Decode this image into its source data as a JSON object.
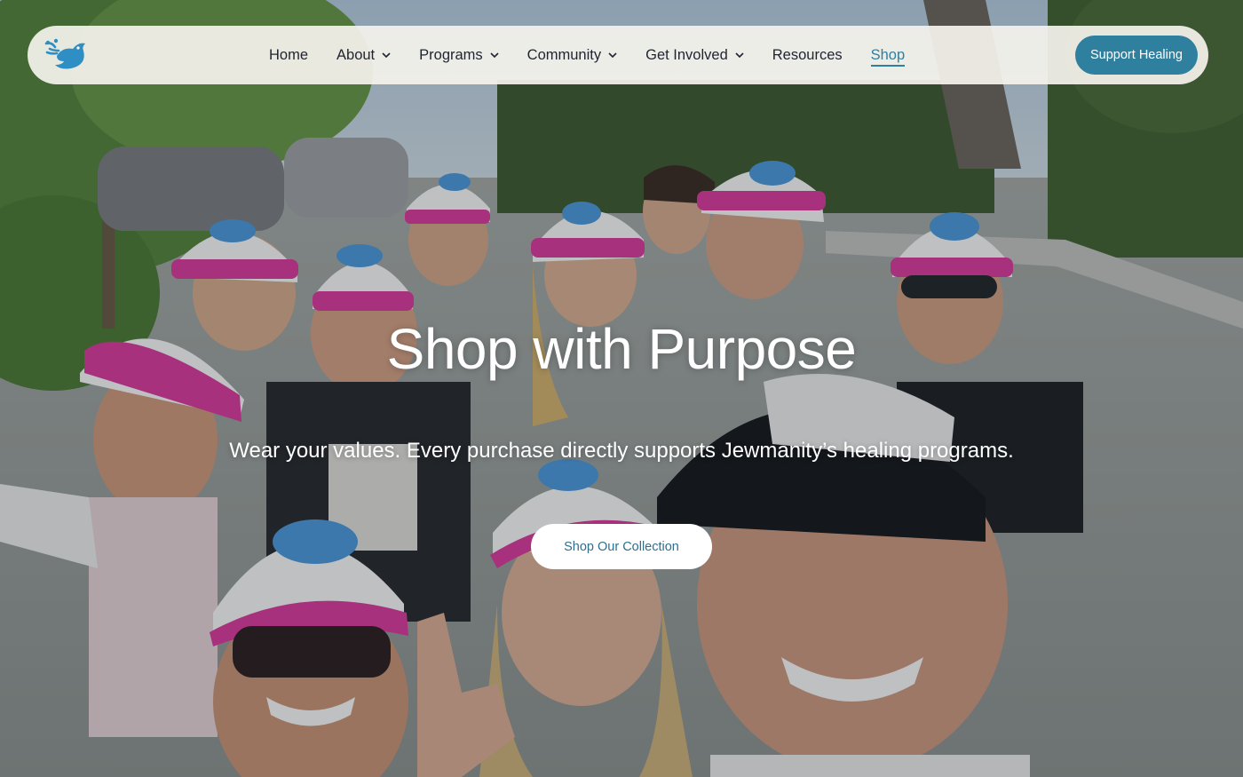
{
  "brand": {
    "logo_icon": "dove-icon",
    "accent_color": "#2f7f9f"
  },
  "nav": {
    "items": [
      {
        "label": "Home",
        "has_dropdown": false,
        "active": false
      },
      {
        "label": "About",
        "has_dropdown": true,
        "active": false
      },
      {
        "label": "Programs",
        "has_dropdown": true,
        "active": false
      },
      {
        "label": "Community",
        "has_dropdown": true,
        "active": false
      },
      {
        "label": "Get Involved",
        "has_dropdown": true,
        "active": false
      },
      {
        "label": "Resources",
        "has_dropdown": false,
        "active": false
      },
      {
        "label": "Shop",
        "has_dropdown": false,
        "active": true
      }
    ],
    "cta_label": "Support Healing"
  },
  "hero": {
    "title": "Shop with Purpose",
    "subtitle": "Wear your values. Every purchase directly supports Jewmanity’s healing programs.",
    "button_label": "Shop Our Collection"
  }
}
